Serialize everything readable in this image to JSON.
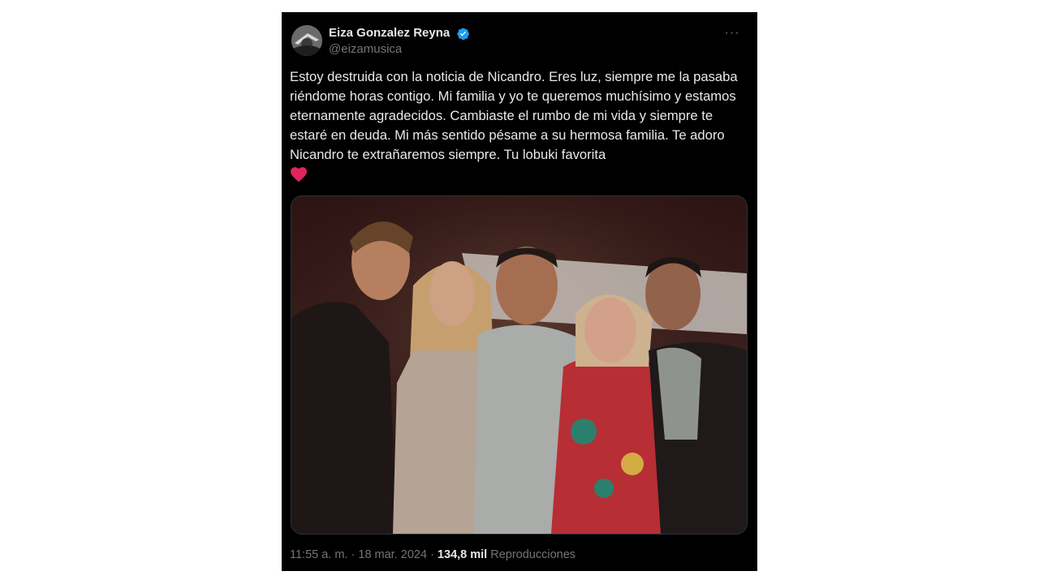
{
  "tweet": {
    "author": {
      "display_name": "Eiza Gonzalez Reyna",
      "handle": "@eizamusica",
      "verified_color": "#1d9bf0",
      "icons": [
        "avatar",
        "verified-badge-icon",
        "more-options-icon"
      ]
    },
    "more_label": "···",
    "text": "Estoy destruida con la noticia de Nicandro. Eres luz, siempre me la pasaba riéndome horas contigo. Mi familia y yo te queremos muchísimo y estamos eternamente agradecidos. Cambiaste el rumbo de mi vida y siempre te estaré en deuda. Mi más sentido pésame a su hermosa familia. Te adoro Nicandro te extrañaremos siempre. Tu lobuki favorita",
    "emoji": "red-heart-icon",
    "heart_color": "#e0245e",
    "meta": {
      "time": "11:55 a. m.",
      "separator": "·",
      "date": "18 mar. 2024",
      "views_count": "134,8 mil",
      "views_label": "Reproducciones"
    }
  }
}
